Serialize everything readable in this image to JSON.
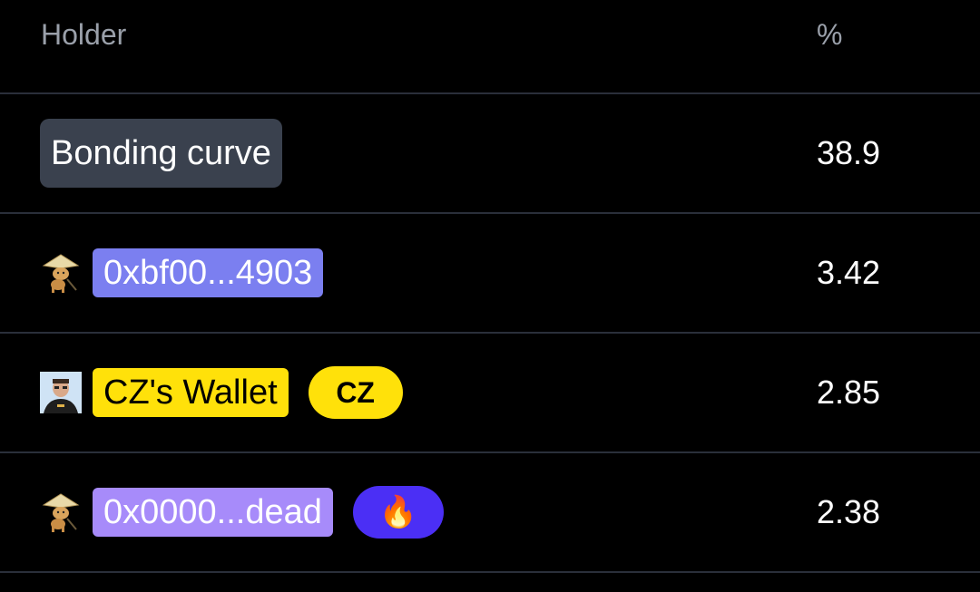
{
  "table": {
    "headers": {
      "holder": "Holder",
      "percent": "%"
    },
    "rows": [
      {
        "type": "bonding",
        "label": "Bonding curve",
        "percent": "38.9"
      },
      {
        "type": "address",
        "avatar_icon": "cat-hat-avatar-icon",
        "address": "0xbf00...4903",
        "tag_color": "#7b7ff0",
        "percent": "3.42"
      },
      {
        "type": "address",
        "avatar_icon": "person-photo-avatar",
        "address": "CZ's Wallet",
        "tag_color": "#ffe10a",
        "badge": "CZ",
        "percent": "2.85"
      },
      {
        "type": "address",
        "avatar_icon": "cat-hat-avatar-icon",
        "address": "0x0000...dead",
        "tag_color": "#a78bfa",
        "badge_icon": "fire-icon",
        "badge_glyph": "🔥",
        "percent": "2.38"
      }
    ]
  }
}
